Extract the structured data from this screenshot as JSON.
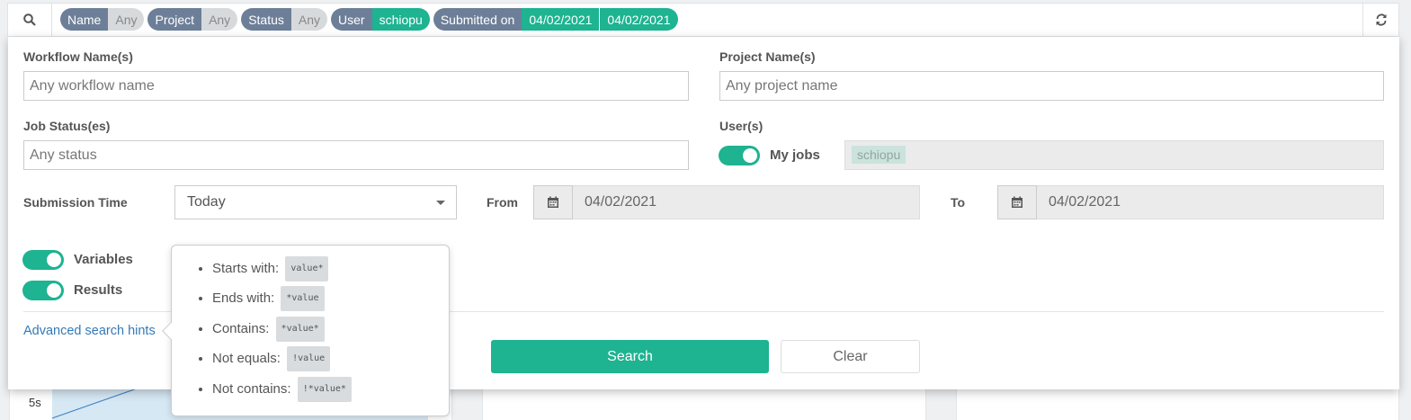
{
  "filter_bar": {
    "chips": [
      {
        "key": "Name",
        "values": [
          "Any"
        ],
        "state": "any"
      },
      {
        "key": "Project",
        "values": [
          "Any"
        ],
        "state": "any"
      },
      {
        "key": "Status",
        "values": [
          "Any"
        ],
        "state": "any"
      },
      {
        "key": "User",
        "values": [
          "schiopu"
        ],
        "state": "set"
      },
      {
        "key": "Submitted on",
        "values": [
          "04/02/2021",
          "04/02/2021"
        ],
        "state": "set"
      }
    ],
    "search_icon": "search-icon",
    "refresh_icon": "refresh-icon"
  },
  "form": {
    "workflow_label": "Workflow Name(s)",
    "workflow_placeholder": "Any workflow name",
    "project_label": "Project Name(s)",
    "project_placeholder": "Any project name",
    "status_label": "Job Status(es)",
    "status_placeholder": "Any status",
    "users_label": "User(s)",
    "my_jobs_label": "My jobs",
    "user_tag": "schiopu",
    "submission_label": "Submission Time",
    "submission_value": "Today",
    "from_label": "From",
    "from_value": "04/02/2021",
    "to_label": "To",
    "to_value": "04/02/2021",
    "variables_label": "Variables",
    "results_label": "Results",
    "hints_link": "Advanced search hints",
    "search_button": "Search",
    "clear_button": "Clear"
  },
  "hints": [
    {
      "label": "Starts with:",
      "code": "value*"
    },
    {
      "label": "Ends with:",
      "code": "*value"
    },
    {
      "label": "Contains:",
      "code": "*value*"
    },
    {
      "label": "Not equals:",
      "code": "!value"
    },
    {
      "label": "Not contains:",
      "code": "!*value*"
    }
  ],
  "background": {
    "chart_tick": "5s"
  },
  "colors": {
    "accent": "#1eb391",
    "chip_key": "#6d7f98",
    "link": "#337ab7"
  }
}
